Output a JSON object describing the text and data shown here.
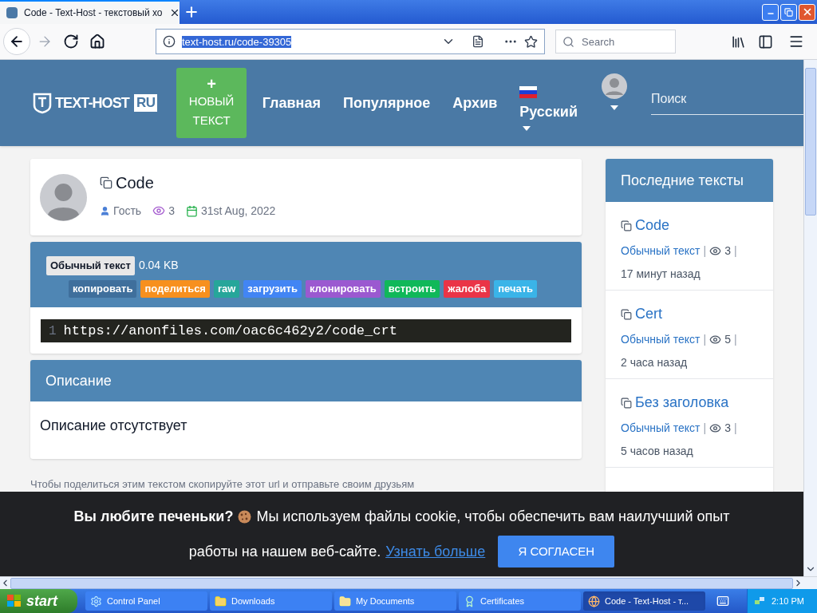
{
  "browser": {
    "tab": {
      "title": "Code - Text-Host - текстовый хо",
      "selected": true
    },
    "nav_buttons": [
      {
        "kind": "back",
        "disabled": false
      },
      {
        "kind": "forward",
        "disabled": true
      },
      {
        "kind": "reload",
        "disabled": false
      },
      {
        "kind": "home",
        "disabled": false
      }
    ],
    "address": {
      "value": "text-host.ru/code-39305",
      "selected": true
    },
    "search": {
      "placeholder": "Search"
    }
  },
  "site_header": {
    "logo": {
      "name": "TEXT-HOST",
      "tag": "RU"
    },
    "new_button": {
      "icon": "+",
      "label": "НОВЫЙ ТЕКСТ"
    },
    "nav": [
      "Главная",
      "Популярное",
      "Архив"
    ],
    "language": "Русский",
    "search": {
      "placeholder": "Поиск"
    }
  },
  "post": {
    "title": "Code",
    "author": "Гость",
    "views": "3",
    "date": "31st Aug, 2022"
  },
  "paste": {
    "syntax": "Обычный текст",
    "size": "0.04 KB",
    "actions": [
      {
        "label": "копировать",
        "color": "#3f6f9c"
      },
      {
        "label": "поделиться",
        "color": "#f7901e"
      },
      {
        "label": "raw",
        "color": "#26a69a"
      },
      {
        "label": "загрузить",
        "color": "#4285f4"
      },
      {
        "label": "клонировать",
        "color": "#9b59d0"
      },
      {
        "label": "встроить",
        "color": "#10b859"
      },
      {
        "label": "жалоба",
        "color": "#ea3447"
      },
      {
        "label": "печать",
        "color": "#3ab4e8"
      }
    ],
    "lines": [
      {
        "number": "1",
        "text": "https://anonfiles.com/oac6c462y2/code_crt"
      }
    ]
  },
  "description": {
    "heading": "Описание",
    "text": "Описание отсутствует"
  },
  "share_note": "Чтобы поделиться этим текстом скопируйте этот url и отправьте своим друзьям",
  "sidebar": {
    "heading": "Последние тексты",
    "items": [
      {
        "title": "Code",
        "syntax": "Обычный текст",
        "separators": [
          "|",
          "|"
        ],
        "views": "3",
        "age": "17 минут назад"
      },
      {
        "title": "Cert",
        "syntax": "Обычный текст",
        "separators": [
          "|",
          "|"
        ],
        "views": "5",
        "age": "2 часа назад"
      },
      {
        "title": "Без заголовка",
        "syntax": "Обычный текст",
        "separators": [
          "|",
          "|"
        ],
        "views": "3",
        "age": "5 часов назад"
      }
    ]
  },
  "cookie_bar": {
    "title": "Вы любите печеньки?",
    "message_lines": [
      "Мы используем файлы cookie, чтобы обеспечить вам наилучший опыт",
      "работы на нашем веб-сайте."
    ],
    "link": "Узнать больше",
    "button": "Я СОГЛАСЕН"
  },
  "taskbar": {
    "start": "start",
    "tasks": [
      {
        "label": "Control Panel",
        "kind": "control",
        "selected": false
      },
      {
        "label": "Downloads",
        "kind": "folder",
        "selected": false
      },
      {
        "label": "My Documents",
        "kind": "documents",
        "selected": false
      },
      {
        "label": "Certificates",
        "kind": "certificate",
        "selected": false
      },
      {
        "label": "Code - Text-Host - т...",
        "kind": "browser",
        "selected": true
      }
    ],
    "time": "2:10 PM"
  }
}
